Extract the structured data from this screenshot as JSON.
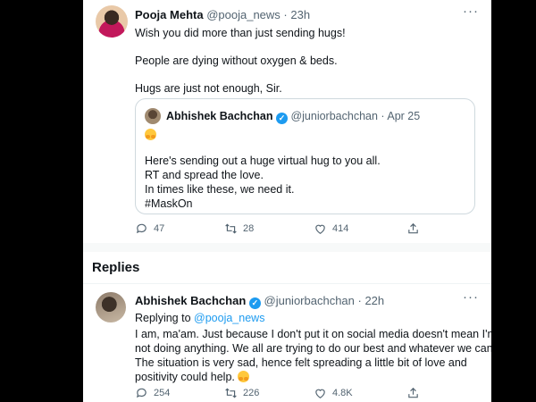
{
  "tweet": {
    "name": "Pooja Mehta",
    "handle": "@pooja_news",
    "time": "· 23h",
    "lines": [
      "Wish you did more than just sending hugs!",
      "People are dying without oxygen & beds.",
      "Hugs are just not enough, Sir."
    ],
    "quote": {
      "name": "Abhishek Bachchan",
      "handle": "@juniorbachchan",
      "time": "· Apr 25",
      "lines": [
        "Here's sending out a huge virtual hug to you all.",
        "RT and spread the love.",
        "In times like these, we need it.",
        "#MaskOn"
      ]
    },
    "replies_count": "47",
    "retweets_count": "28",
    "likes_count": "414"
  },
  "replies_section": {
    "title": "Replies"
  },
  "reply": {
    "name": "Abhishek Bachchan",
    "handle": "@juniorbachchan",
    "time": "· 22h",
    "replying_prefix": "Replying to",
    "replying_handle": "@pooja_news",
    "lines": [
      "I am, ma'am. Just because I don't put it on social media doesn't mean I'm",
      "not doing anything. We all are trying to do our best and whatever we can.",
      "The situation is very sad, hence felt spreading a little bit of love and",
      "positivity could help."
    ],
    "replies_count": "254",
    "retweets_count": "226",
    "likes_count": "4.8K"
  },
  "icons": {
    "more": "more-dots-icon",
    "verified": "verified-badge-icon",
    "hug": "hugging-face-emoji-icon",
    "reply": "reply-bubble-icon",
    "retweet": "retweet-icon",
    "like": "heart-icon",
    "share": "share-icon"
  },
  "colors": {
    "accent": "#1d9bf0",
    "text": "#0f1419",
    "muted": "#536471",
    "border": "#cfd9de",
    "backdrop": "#000000"
  }
}
